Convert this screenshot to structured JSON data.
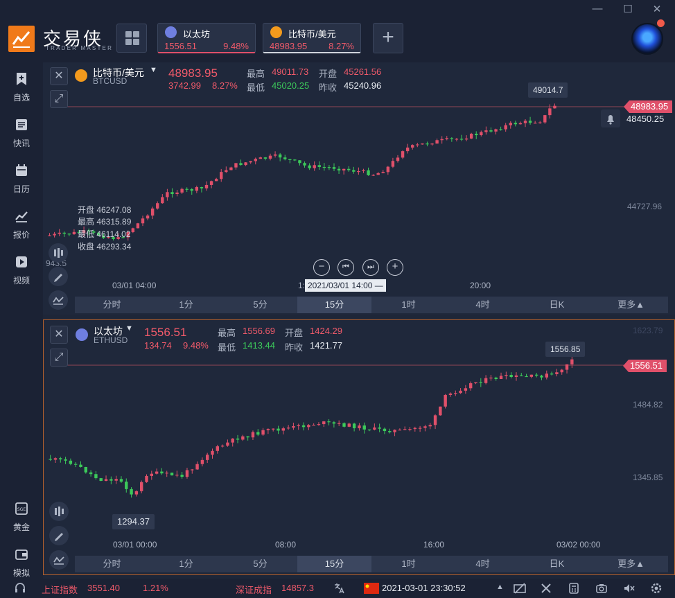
{
  "app": {
    "brand_name": "交易侠",
    "brand_sub": "TRADER MASTER"
  },
  "tickers": [
    {
      "name": "以太坊",
      "price": "1556.51",
      "pct": "9.48%",
      "coin_color": "#6f7fe0"
    },
    {
      "name": "比特币/美元",
      "price": "48983.95",
      "pct": "8.27%",
      "coin_color": "#f39a1d"
    }
  ],
  "sidebar": [
    {
      "label": "自选",
      "icon": "bookmark-icon"
    },
    {
      "label": "快讯",
      "icon": "news-icon"
    },
    {
      "label": "日历",
      "icon": "calendar-icon"
    },
    {
      "label": "报价",
      "icon": "line-chart-icon"
    },
    {
      "label": "视频",
      "icon": "video-icon"
    },
    {
      "label": "黄金",
      "icon": "gold-icon"
    },
    {
      "label": "模拟",
      "icon": "wallet-icon"
    }
  ],
  "chart1": {
    "name": "比特币/美元",
    "code": "BTCUSD",
    "price": "48983.95",
    "change": "3742.99",
    "change_pct": "8.27%",
    "high_label": "最高",
    "high": "49011.73",
    "open_label": "开盘",
    "open": "45261.56",
    "low_label": "最低",
    "low": "45020.25",
    "prev_label": "昨收",
    "prev": "45240.96",
    "tip_high": "49014.7",
    "tag_price": "48983.95",
    "axis_mid": "48450.25",
    "axis_low": "44727.96",
    "axis_left": "943.5",
    "ohlc_open": "开盘 46247.08",
    "ohlc_high": "最高 46315.89",
    "ohlc_low": "最低 46114.02",
    "ohlc_close": "收盘 46293.34",
    "x_labels": [
      "03/01 04:00",
      "20:00"
    ],
    "x_cursor": "2021/03/01 14:00 —",
    "x_cursor_prefix": "1:"
  },
  "chart2": {
    "name": "以太坊",
    "code": "ETHUSD",
    "price": "1556.51",
    "change": "134.74",
    "change_pct": "9.48%",
    "high_label": "最高",
    "high": "1556.69",
    "open_label": "开盘",
    "open": "1424.29",
    "low_label": "最低",
    "low": "1413.44",
    "prev_label": "昨收",
    "prev": "1421.77",
    "tip_high": "1556.85",
    "tip_low": "1294.37",
    "tag_price": "1556.51",
    "axis_top": "1623.79",
    "axis_mid": "1484.82",
    "axis_low": "1345.85",
    "x_labels": [
      "03/01 00:00",
      "08:00",
      "16:00",
      "03/02 00:00"
    ]
  },
  "timeframes": [
    "分时",
    "1分",
    "5分",
    "15分",
    "1时",
    "4时",
    "日K",
    "更多▲"
  ],
  "selected_timeframe": "15分",
  "status": {
    "idx1_name": "上证指数",
    "idx1_value": "3551.40",
    "idx1_pct": "1.21%",
    "idx2_name": "深证成指",
    "idx2_value": "14857.3",
    "datetime": "2021-03-01 23:30:52"
  },
  "colors": {
    "up": "#e0506a",
    "down": "#3cc95a",
    "accent": "#f07a1a"
  }
}
